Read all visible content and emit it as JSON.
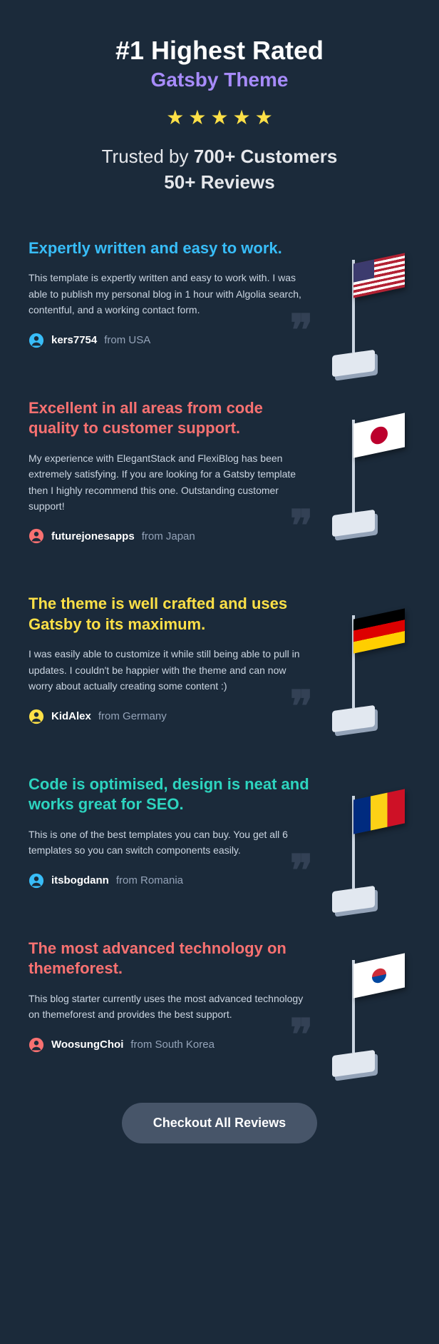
{
  "hero": {
    "title": "#1 Highest Rated",
    "subtitle": "Gatsby Theme",
    "trust_prefix": "Trusted by ",
    "trust_customers": "700+ Customers",
    "trust_reviews": "50+ Reviews"
  },
  "reviews": [
    {
      "title": "Expertly written and easy to work.",
      "body": "This template is expertly written and easy to work with. I was able to publish my personal blog in 1 hour with Algolia search, contentful, and a working contact form.",
      "author": "kers7754",
      "location": "from USA",
      "color": "c-blue",
      "icon_color": "#38bdf8",
      "flag": "flag-usa"
    },
    {
      "title": "Excellent in all areas from code quality to customer support.",
      "body": "My experience with ElegantStack and FlexiBlog has been extremely satisfying. If you are looking for a Gatsby template then I highly recommend this one. Outstanding customer support!",
      "author": "futurejonesapps",
      "location": "from Japan",
      "color": "c-red",
      "icon_color": "#f87171",
      "flag": "flag-japan"
    },
    {
      "title": "The theme is well crafted and uses Gatsby to its maximum.",
      "body": "I was easily able to customize it while still being able to pull in updates. I couldn't be happier with the theme and can now worry about actually creating some content :)",
      "author": "KidAlex",
      "location": "from Germany",
      "color": "c-yellow",
      "icon_color": "#fde047",
      "flag": "flag-germany"
    },
    {
      "title": "Code is optimised, design is neat and works great for SEO.",
      "body": "This is one of the best templates you can buy. You get all 6 templates so you can switch components easily.",
      "author": "itsbogdann",
      "location": "from Romania",
      "color": "c-teal",
      "icon_color": "#38bdf8",
      "flag": "flag-romania"
    },
    {
      "title": "The most advanced technology on themeforest.",
      "body": "This blog starter currently uses the most advanced technology on themeforest and provides the best support.",
      "author": "WoosungChoi",
      "location": "from South Korea",
      "color": "c-red",
      "icon_color": "#f87171",
      "flag": "flag-korea"
    }
  ],
  "cta": {
    "label": "Checkout All Reviews"
  }
}
